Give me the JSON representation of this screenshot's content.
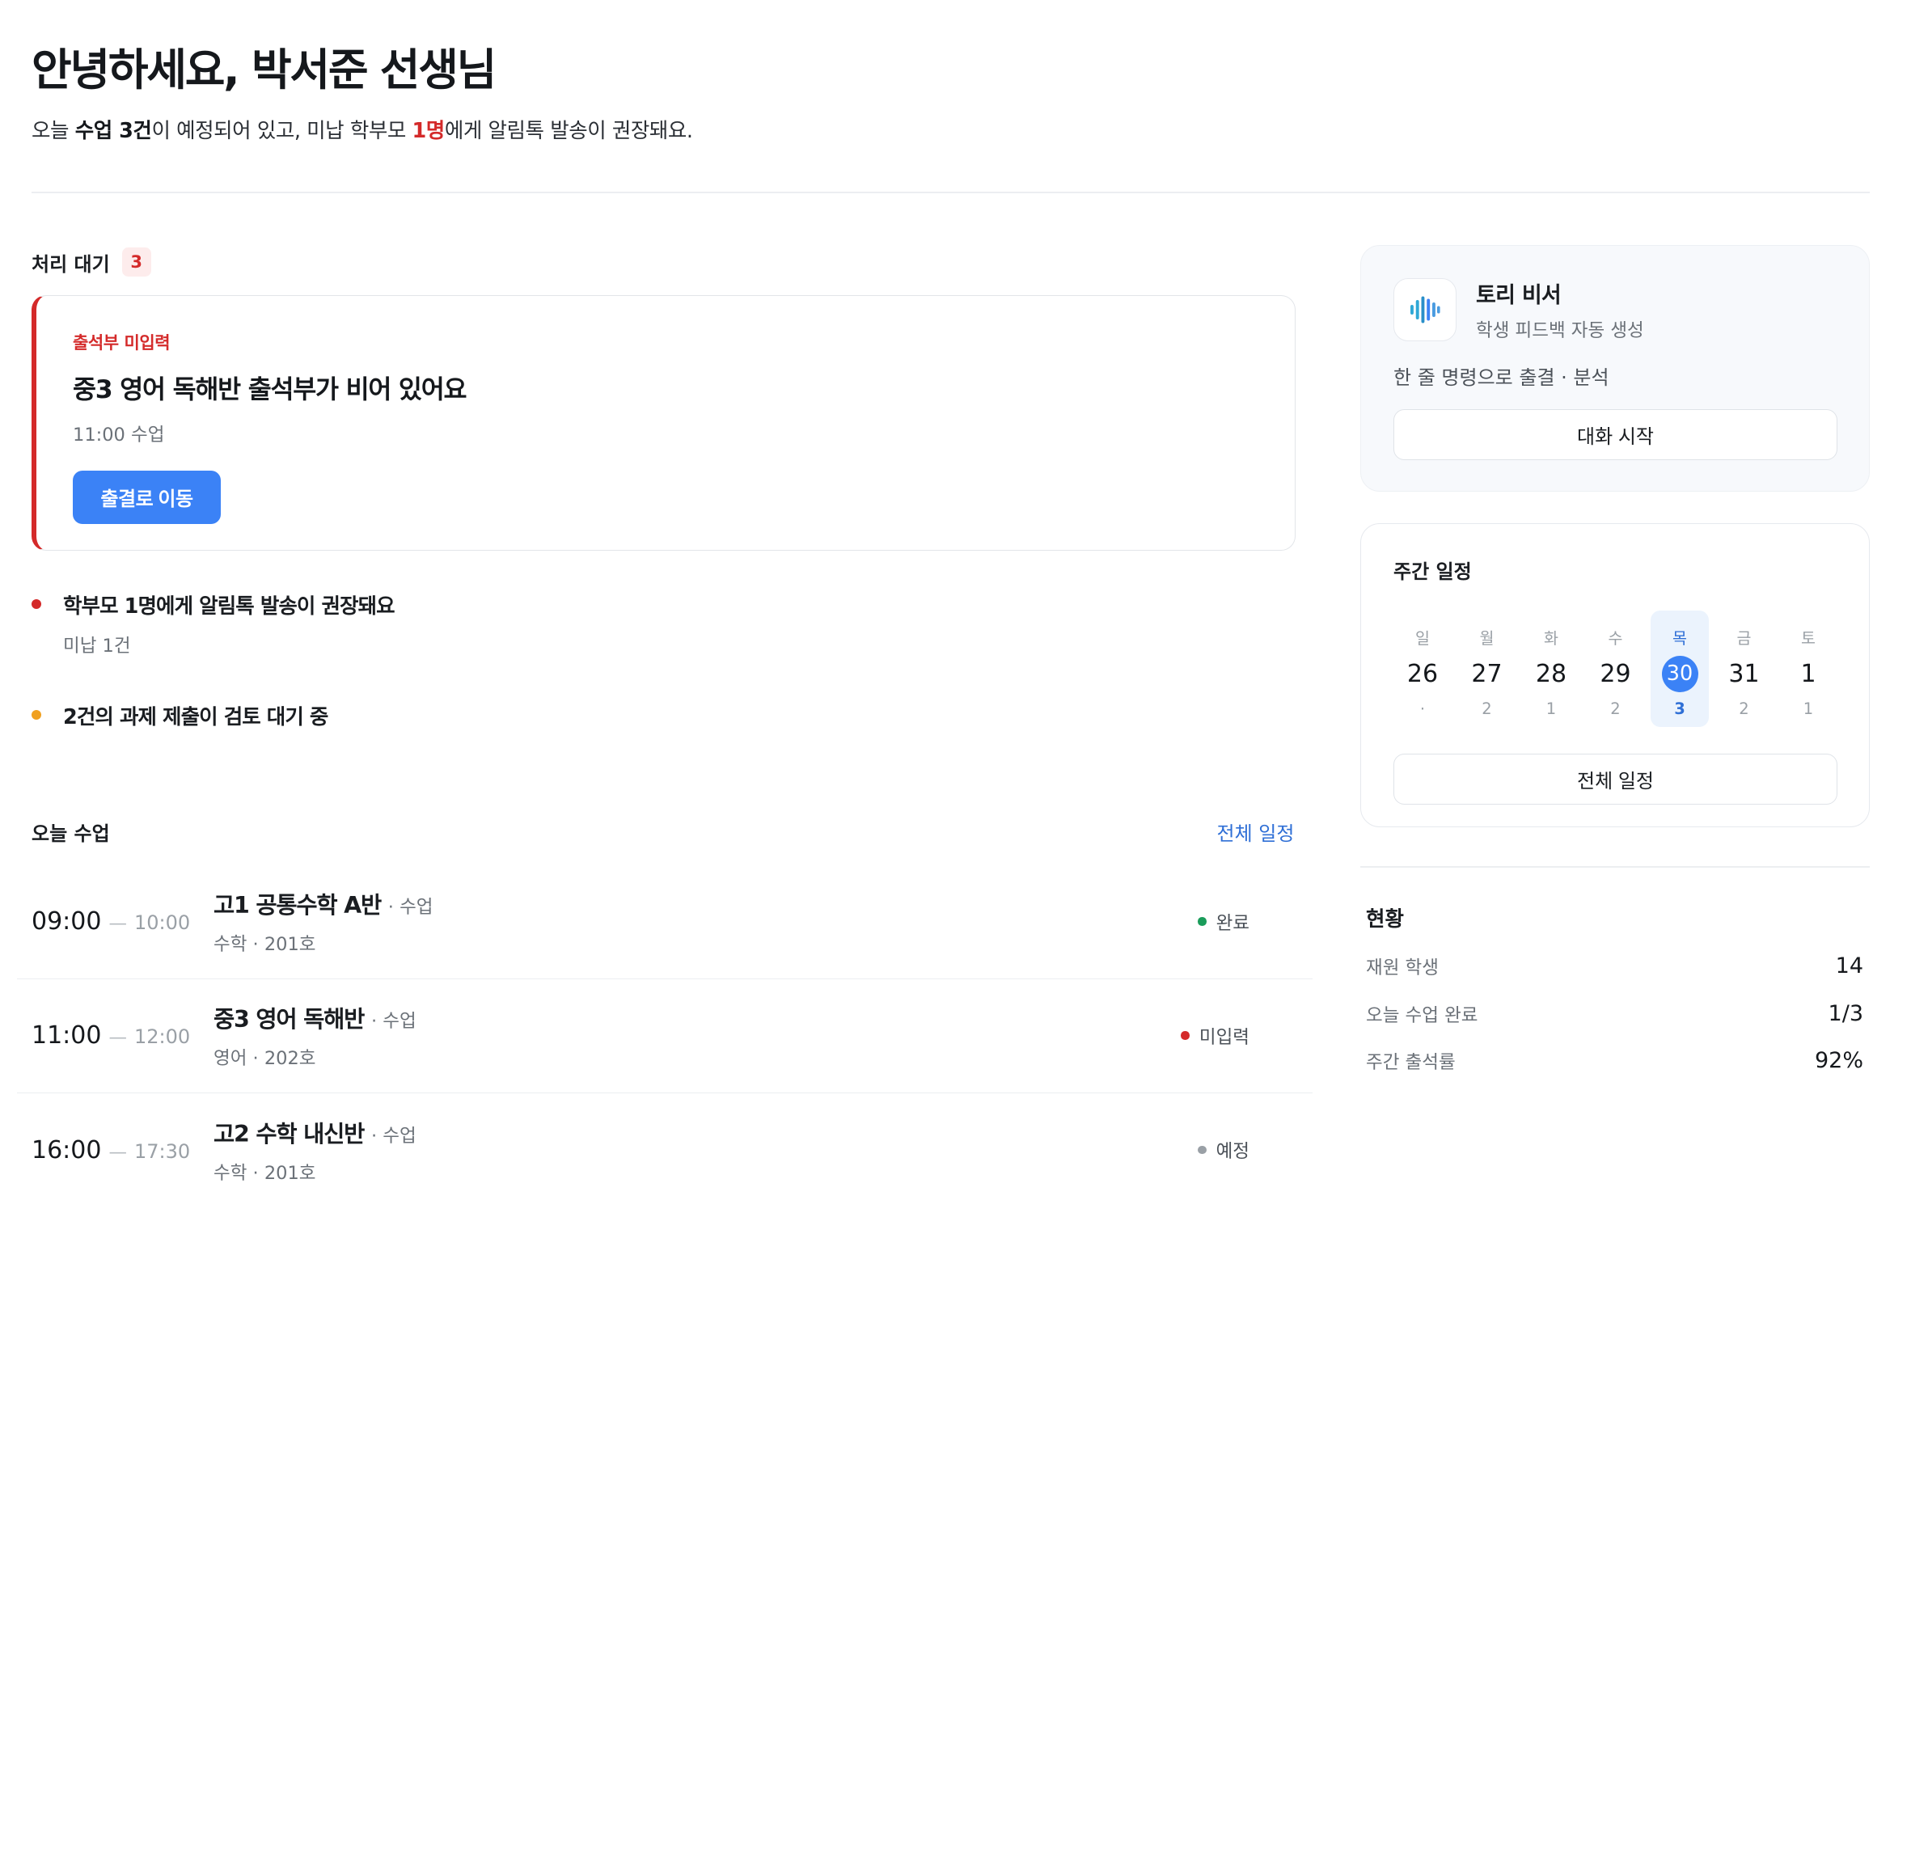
{
  "header": {
    "greeting": "안녕하세요, 박서준 선생님",
    "summary_prefix": "오늘 ",
    "summary_classes": "수업 3건",
    "summary_mid": "이 예정되어 있고, 미납 학부모 ",
    "summary_parents": "1명",
    "summary_suffix": "에게 알림톡 발송이 권장돼요."
  },
  "pending": {
    "title": "처리 대기",
    "count": "3",
    "alert": {
      "tag": "출석부 미입력",
      "title": "중3 영어 독해반 출석부가 비어 있어요",
      "time": "11:00 수업",
      "button": "출결로 이동"
    },
    "notices": [
      {
        "title": "학부모 1명에게 알림톡 발송이 권장돼요",
        "sub": "미납 1건",
        "color": "#d42a2a"
      },
      {
        "title": "2건의 과제 제출이 검토 대기 중",
        "sub": "",
        "color": "#f0a020"
      }
    ]
  },
  "today": {
    "title": "오늘 수업",
    "link": "전체 일정",
    "classes": [
      {
        "start": "09:00",
        "end": "10:00",
        "name": "고1 공통수학 A반",
        "kind": "· 수업",
        "sub": "수학 · 201호",
        "status": "완료",
        "status_color": "#1a9c5a"
      },
      {
        "start": "11:00",
        "end": "12:00",
        "name": "중3 영어 독해반",
        "kind": "· 수업",
        "sub": "영어 · 202호",
        "status": "미입력",
        "status_color": "#d42a2a"
      },
      {
        "start": "16:00",
        "end": "17:30",
        "name": "고2 수학 내신반",
        "kind": "· 수업",
        "sub": "수학 · 201호",
        "status": "예정",
        "status_color": "#9aa0a6"
      }
    ]
  },
  "assistant": {
    "name": "토리 비서",
    "desc": "학생 피드백 자동 생성",
    "command": "한 줄 명령으로 출결 · 분석",
    "button": "대화 시작"
  },
  "week": {
    "title": "주간 일정",
    "days": [
      {
        "w": "일",
        "d": "26",
        "c": "·"
      },
      {
        "w": "월",
        "d": "27",
        "c": "2"
      },
      {
        "w": "화",
        "d": "28",
        "c": "1"
      },
      {
        "w": "수",
        "d": "29",
        "c": "2"
      },
      {
        "w": "목",
        "d": "30",
        "c": "3",
        "active": true
      },
      {
        "w": "금",
        "d": "31",
        "c": "2"
      },
      {
        "w": "토",
        "d": "1",
        "c": "1"
      }
    ],
    "button": "전체 일정"
  },
  "stats": {
    "title": "현황",
    "rows": [
      {
        "label": "재원 학생",
        "value": "14"
      },
      {
        "label": "오늘 수업 완료",
        "value": "1/3"
      },
      {
        "label": "주간 출석률",
        "value": "92%"
      }
    ]
  }
}
